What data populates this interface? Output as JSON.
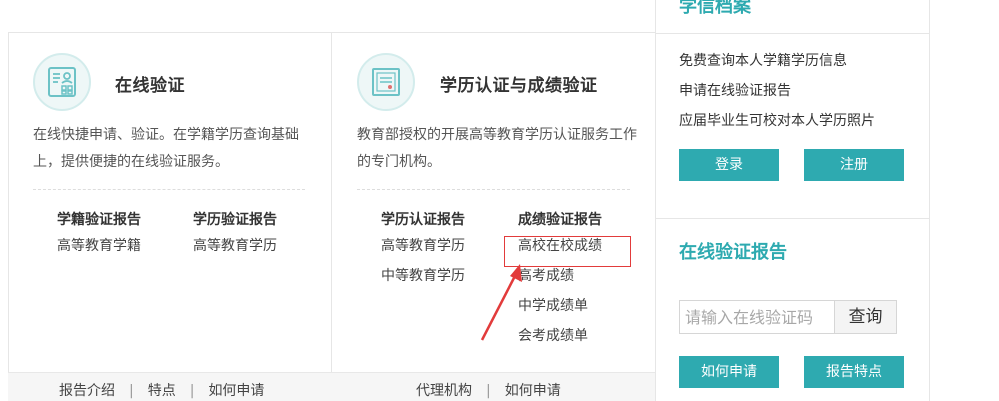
{
  "cards": [
    {
      "title": "在线验证",
      "icon": "id-card-icon",
      "description": "在线快捷申请、验证。在学籍学历查询基础上，提供便捷的在线验证服务。",
      "columns": [
        {
          "heading": "学籍验证报告",
          "items": [
            "高等教育学籍"
          ]
        },
        {
          "heading": "学历验证报告",
          "items": [
            "高等教育学历"
          ]
        }
      ],
      "footer_links": [
        "报告介绍",
        "特点",
        "如何申请"
      ]
    },
    {
      "title": "学历认证与成绩验证",
      "icon": "certificate-icon",
      "description": "教育部授权的开展高等教育学历认证服务工作的专门机构。",
      "columns": [
        {
          "heading": "学历认证报告",
          "items": [
            "高等教育学历",
            "中等教育学历"
          ]
        },
        {
          "heading": "成绩验证报告",
          "items": [
            "高校在校成绩",
            "高考成绩",
            "中学成绩单",
            "会考成绩单"
          ]
        }
      ],
      "footer_links": [
        "代理机构",
        "如何申请"
      ]
    }
  ],
  "footer_separator": "|",
  "sidebar": {
    "archive": {
      "title": "学信档案",
      "links": [
        "免费查询本人学籍学历信息",
        "申请在线验证报告",
        "应届毕业生可校对本人学历照片"
      ],
      "login_label": "登录",
      "register_label": "注册"
    },
    "verify": {
      "title": "在线验证报告",
      "input_placeholder": "请输入在线验证码",
      "search_label": "查询",
      "howto_label": "如何申请",
      "features_label": "报告特点"
    }
  },
  "colors": {
    "accent": "#2eaab0",
    "highlight": "#e23b3b"
  }
}
